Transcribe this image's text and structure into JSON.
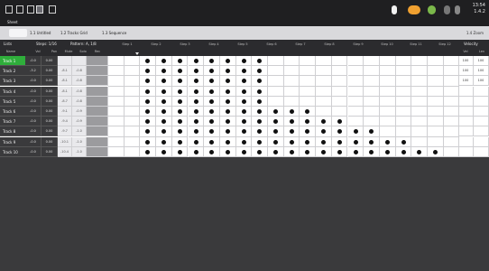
{
  "window": {
    "title": "Sheet"
  },
  "status": {
    "time": "13:54",
    "date": "1.4.2"
  },
  "tabs": [
    {
      "label": "1.1 Untitled"
    },
    {
      "label": "1.2 Tracks Grid"
    },
    {
      "label": "1.3 Sequence"
    }
  ],
  "tabs_right_label": "1.4 Zoom",
  "header": {
    "left1": "Lists",
    "left2": "Steps: 1/16",
    "left3": "Pattern: A, 1/8",
    "right": "Velocity"
  },
  "track_columns": [
    "Name",
    "Vol",
    "Pan",
    "Mute",
    "Solo",
    "Rec"
  ],
  "step_columns": [
    "Step 1",
    "Step 2",
    "Step 3",
    "Step 4",
    "Step 5",
    "Step 6",
    "Step 7",
    "Step 8",
    "Step 9",
    "Step 10",
    "Step 11",
    "Step 12"
  ],
  "right_columns": [
    "Vel",
    "Len"
  ],
  "rows": [
    {
      "name": "Track 1",
      "vals": [
        "-0.0",
        "0.00"
      ],
      "a": "",
      "b": "",
      "active": true,
      "steps": 8,
      "right": [
        "100",
        "100"
      ]
    },
    {
      "name": "Track 2",
      "vals": [
        "-3.2",
        "0.00"
      ],
      "a": "-8.1",
      "b": "-0.8",
      "active": false,
      "steps": 8,
      "right": [
        "100",
        "100"
      ]
    },
    {
      "name": "Track 3",
      "vals": [
        "-0.0",
        "0.00"
      ],
      "a": "-8.1",
      "b": "-0.8",
      "active": false,
      "steps": 8,
      "right": [
        "100",
        "100"
      ]
    },
    {
      "name": "Track 4",
      "vals": [
        "-0.0",
        "0.00"
      ],
      "a": "-8.1",
      "b": "-0.8",
      "active": false,
      "steps": 8,
      "right": [
        "",
        ""
      ]
    },
    {
      "name": "Track 5",
      "vals": [
        "-0.0",
        "0.00"
      ],
      "a": "-8.7",
      "b": "-0.8",
      "active": false,
      "steps": 8,
      "right": [
        "",
        ""
      ]
    },
    {
      "name": "Track 6",
      "vals": [
        "-0.0",
        "0.00"
      ],
      "a": "-9.1",
      "b": "-0.9",
      "active": false,
      "steps": 11,
      "right": [
        "",
        ""
      ]
    },
    {
      "name": "Track 7",
      "vals": [
        "-0.0",
        "0.00"
      ],
      "a": "-9.4",
      "b": "-0.9",
      "active": false,
      "steps": 13,
      "right": [
        "",
        ""
      ]
    },
    {
      "name": "Track 8",
      "vals": [
        "-0.0",
        "0.00"
      ],
      "a": "-9.7",
      "b": "-1.0",
      "active": false,
      "steps": 15,
      "right": [
        "",
        ""
      ]
    },
    {
      "name": "Track 9",
      "vals": [
        "-0.0",
        "0.00"
      ],
      "a": "-10.1",
      "b": "-1.0",
      "active": false,
      "steps": 17,
      "right": [
        "",
        ""
      ]
    },
    {
      "name": "Track 10",
      "vals": [
        "-0.0",
        "0.00"
      ],
      "a": "-10.4",
      "b": "-1.0",
      "active": false,
      "steps": 19,
      "right": [
        "",
        ""
      ]
    }
  ],
  "colors": {
    "accent": "#2fae3b",
    "dark": "#3a3a3c",
    "grid": "#ffffff"
  }
}
